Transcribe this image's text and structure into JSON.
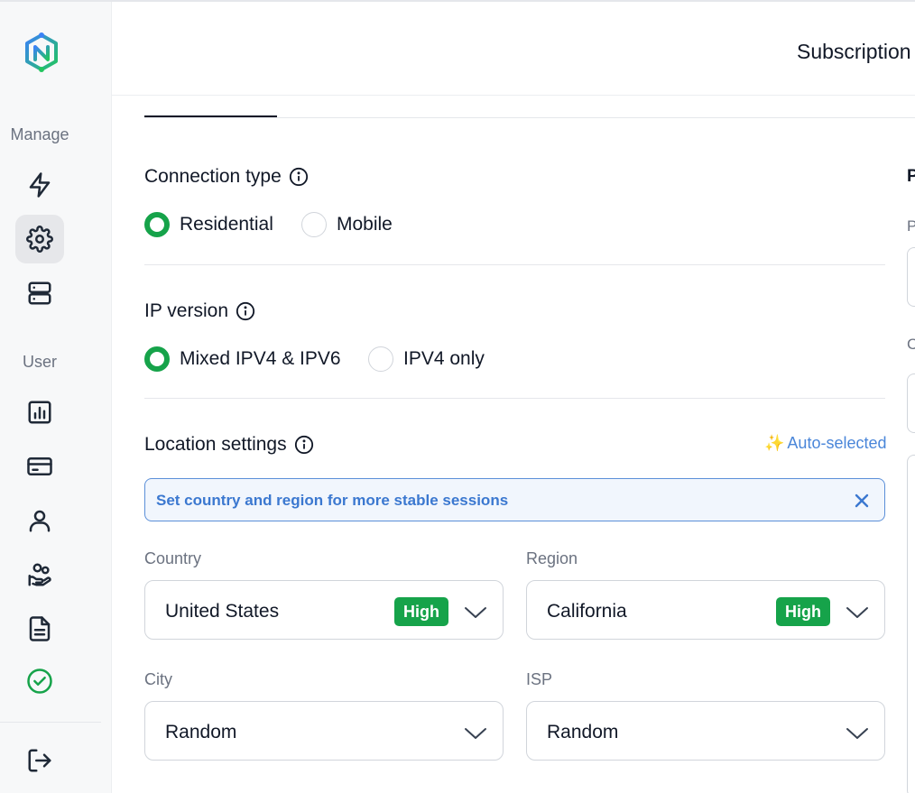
{
  "app": {
    "header_title": "Subscription",
    "accent_color": "#16a34a",
    "info_color": "#3b78d0"
  },
  "sidebar": {
    "logo_icon": "brand-logo",
    "manage_label": "Manage",
    "user_label": "User",
    "manage_items": [
      {
        "name": "bolt-icon",
        "active": false
      },
      {
        "name": "settings-icon",
        "active": true
      },
      {
        "name": "server-icon",
        "active": false
      }
    ],
    "user_items": [
      {
        "name": "chart-icon"
      },
      {
        "name": "credit-card-icon"
      },
      {
        "name": "user-icon"
      },
      {
        "name": "referral-icon"
      },
      {
        "name": "document-icon"
      },
      {
        "name": "check-circle-icon"
      }
    ],
    "logout_icon": "logout-icon"
  },
  "connection_type": {
    "title": "Connection type",
    "options": [
      {
        "label": "Residential",
        "checked": true
      },
      {
        "label": "Mobile",
        "checked": false
      }
    ]
  },
  "ip_version": {
    "title": "IP version",
    "options": [
      {
        "label": "Mixed IPV4 & IPV6",
        "checked": true
      },
      {
        "label": "IPV4 only",
        "checked": false
      }
    ]
  },
  "location": {
    "title": "Location settings",
    "auto_selected": "Auto-selected",
    "banner_text": "Set country and region for more stable sessions",
    "country": {
      "label": "Country",
      "value": "United States",
      "badge": "High"
    },
    "region": {
      "label": "Region",
      "value": "California",
      "badge": "High"
    },
    "city": {
      "label": "City",
      "value": "Random"
    },
    "isp": {
      "label": "ISP",
      "value": "Random"
    }
  },
  "right_panel": {
    "heading_fragment": "P",
    "label_1_fragment": "P",
    "label_2_fragment": "C"
  }
}
